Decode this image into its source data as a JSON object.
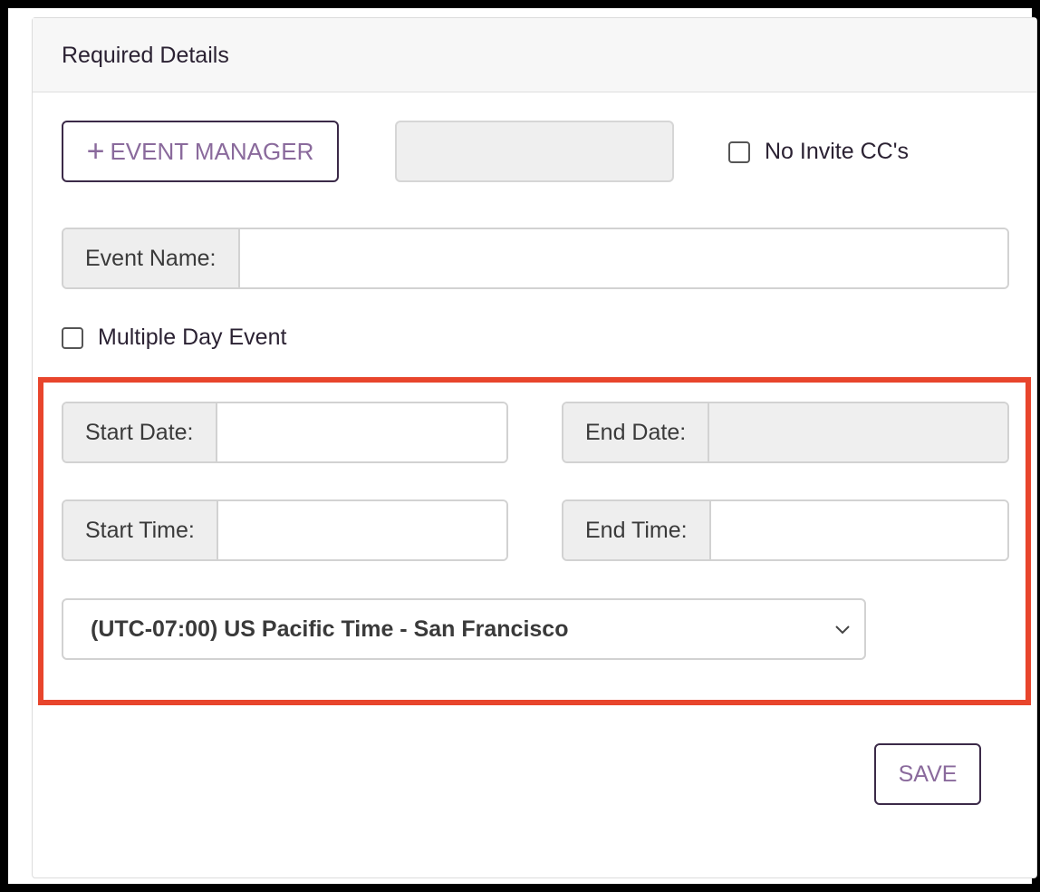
{
  "panel": {
    "title": "Required Details"
  },
  "top_row": {
    "event_manager_label": "EVENT MANAGER",
    "no_invite_cc_label": "No Invite CC's"
  },
  "event_name": {
    "label": "Event Name:",
    "value": ""
  },
  "multiple_day_label": "Multiple Day Event",
  "dates": {
    "start_date_label": "Start Date:",
    "end_date_label": "End Date:",
    "start_time_label": "Start Time:",
    "end_time_label": "End Time:"
  },
  "timezone": {
    "selected": "(UTC-07:00) US Pacific Time - San Francisco"
  },
  "footer": {
    "save_label": "SAVE"
  },
  "colors": {
    "accent_text": "#8a6a9c",
    "button_border": "#3b2a48",
    "highlight_border": "#e8452c"
  },
  "icons": [
    "plus-icon",
    "chevron-down-icon"
  ]
}
